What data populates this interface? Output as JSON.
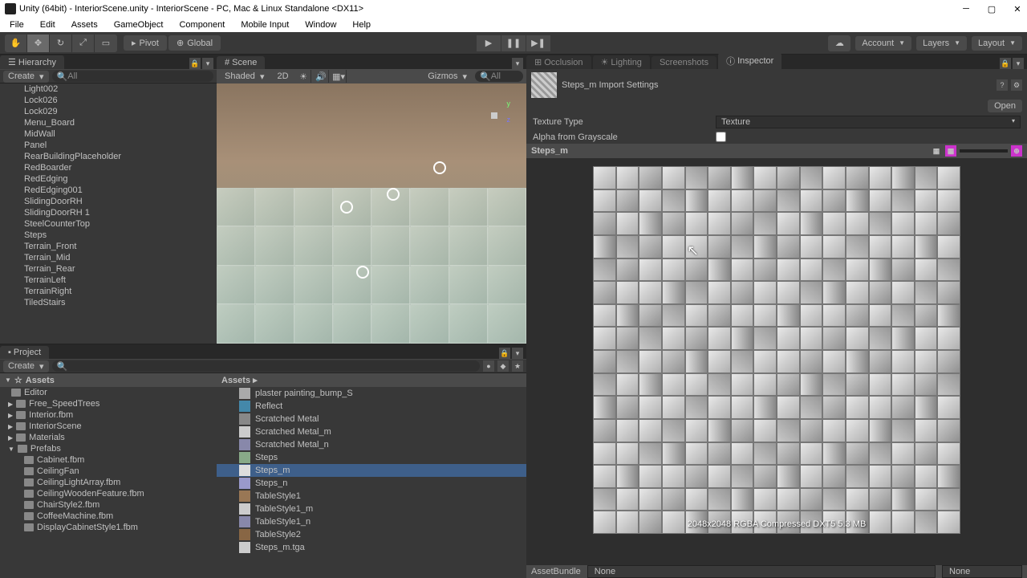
{
  "titlebar": {
    "text": "Unity (64bit) - InteriorScene.unity - InteriorScene - PC, Mac & Linux Standalone <DX11>"
  },
  "menu": [
    "File",
    "Edit",
    "Assets",
    "GameObject",
    "Component",
    "Mobile Input",
    "Window",
    "Help"
  ],
  "toolbar": {
    "pivot_label": "Pivot",
    "global_label": "Global",
    "account": "Account",
    "layers": "Layers",
    "layout": "Layout"
  },
  "hierarchy": {
    "tab": "Hierarchy",
    "create": "Create",
    "search": "All",
    "items": [
      "Light002",
      "Lock026",
      "Lock029",
      "Menu_Board",
      "MidWall",
      "Panel",
      "RearBuildingPlaceholder",
      "RedBoarder",
      "RedEdging",
      "RedEdging001",
      "SlidingDoorRH",
      "SlidingDoorRH 1",
      "SteelCounterTop",
      "Steps",
      "Terrain_Front",
      "Terrain_Mid",
      "Terrain_Rear",
      "TerrainLeft",
      "TerrainRight",
      "TiledStairs"
    ]
  },
  "scene": {
    "tab": "Scene",
    "shading": "Shaded",
    "mode2d": "2D",
    "gizmos": "Gizmos",
    "search": "All"
  },
  "project": {
    "tab": "Project",
    "create": "Create",
    "tree_root": "Assets",
    "tree": [
      {
        "name": "Editor",
        "level": 1,
        "arrow": ""
      },
      {
        "name": "Free_SpeedTrees",
        "level": 1,
        "arrow": "▶"
      },
      {
        "name": "Interior.fbm",
        "level": 1,
        "arrow": "▶"
      },
      {
        "name": "InteriorScene",
        "level": 1,
        "arrow": "▶"
      },
      {
        "name": "Materials",
        "level": 1,
        "arrow": "▶"
      },
      {
        "name": "Prefabs",
        "level": 1,
        "arrow": "▼"
      },
      {
        "name": "Cabinet.fbm",
        "level": 2,
        "arrow": ""
      },
      {
        "name": "CeilingFan",
        "level": 2,
        "arrow": ""
      },
      {
        "name": "CeilingLightArray.fbm",
        "level": 2,
        "arrow": ""
      },
      {
        "name": "CeilingWoodenFeature.fbm",
        "level": 2,
        "arrow": ""
      },
      {
        "name": "ChairStyle2.fbm",
        "level": 2,
        "arrow": ""
      },
      {
        "name": "CoffeeMachine.fbm",
        "level": 2,
        "arrow": ""
      },
      {
        "name": "DisplayCabinetStyle1.fbm",
        "level": 2,
        "arrow": ""
      }
    ],
    "breadcrumb": "Assets ▸",
    "assets": [
      {
        "name": "plaster painting_bump_S",
        "color": "#aaa"
      },
      {
        "name": "Reflect",
        "color": "#48a"
      },
      {
        "name": "Scratched Metal",
        "color": "#888"
      },
      {
        "name": "Scratched Metal_m",
        "color": "#ccc"
      },
      {
        "name": "Scratched Metal_n",
        "color": "#88a"
      },
      {
        "name": "Steps",
        "color": "#8a8"
      },
      {
        "name": "Steps_m",
        "color": "#ddd",
        "selected": true
      },
      {
        "name": "Steps_n",
        "color": "#99c"
      },
      {
        "name": "TableStyle1",
        "color": "#975"
      },
      {
        "name": "TableStyle1_m",
        "color": "#ccc"
      },
      {
        "name": "TableStyle1_n",
        "color": "#88a"
      },
      {
        "name": "TableStyle2",
        "color": "#864"
      },
      {
        "name": "Steps_m.tga",
        "color": "#ccc"
      }
    ]
  },
  "inspector": {
    "tabs": {
      "occlusion": "Occlusion",
      "lighting": "Lighting",
      "screenshots": "Screenshots",
      "inspector": "Inspector"
    },
    "title": "Steps_m Import Settings",
    "open": "Open",
    "texture_type_label": "Texture Type",
    "texture_type_value": "Texture",
    "alpha_label": "Alpha from Grayscale",
    "preview_name": "Steps_m",
    "tex_info": "2048x2048  RGBA Compressed DXT5  5.3 MB",
    "assetbundle_label": "AssetBundle",
    "assetbundle_value": "None",
    "assetbundle_variant": "None"
  }
}
